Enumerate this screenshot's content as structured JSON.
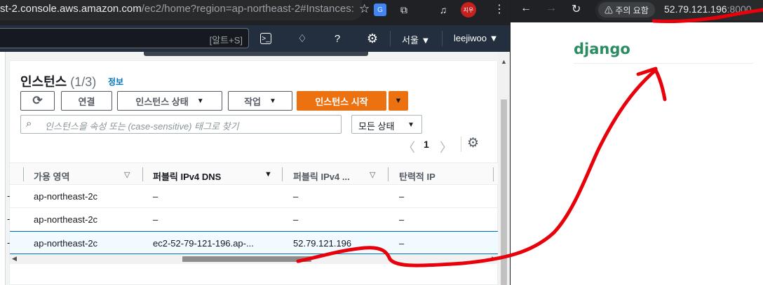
{
  "left_browser": {
    "url_main": "st-2.console.aws.amazon.com",
    "url_rest": "/ec2/home?region=ap-northeast-2#Instances:",
    "profile_badge": "지우",
    "icons": [
      "star-icon",
      "google-translate-icon",
      "extensions-icon",
      "media-icon",
      "profile-avatar",
      "more-icon"
    ]
  },
  "aws_nav": {
    "search_shortcut": "[알트+S]",
    "region": "서울",
    "user": "leejiwoo"
  },
  "instances": {
    "title": "인스턴스",
    "count": "(1/3)",
    "info": "정보",
    "buttons": {
      "connect": "연결",
      "instance_state": "인스턴스 상태",
      "actions": "작업",
      "start": "인스턴스 시작"
    },
    "filter_placeholder": "인스턴스을 속성 또는 (case-sensitive) 태그로 찾기",
    "state_filter": "모든 상태",
    "page": "1",
    "columns": [
      "가용 영역",
      "퍼블릭 IPv4 DNS",
      "퍼블릭 IPv4 ...",
      "탄력적 IP"
    ],
    "rows": [
      {
        "az": "ap-northeast-2c",
        "dns": "–",
        "ip": "–",
        "eip": "–",
        "selected": false
      },
      {
        "az": "ap-northeast-2c",
        "dns": "–",
        "ip": "–",
        "eip": "–",
        "selected": false
      },
      {
        "az": "ap-northeast-2c",
        "dns": "ec2-52-79-121-196.ap-...",
        "ip": "52.79.121.196",
        "eip": "–",
        "selected": true
      }
    ]
  },
  "right_browser": {
    "warning": "⚠ 주의 요함",
    "url_host": "52.79.121.196",
    "url_port": ":8000"
  },
  "django_page": {
    "heading": "django"
  },
  "colors": {
    "aws_nav": "#232f3e",
    "primary": "#ec7211",
    "link": "#0073bb",
    "django_green": "#2c8c61",
    "annotation_red": "#e8000b"
  }
}
